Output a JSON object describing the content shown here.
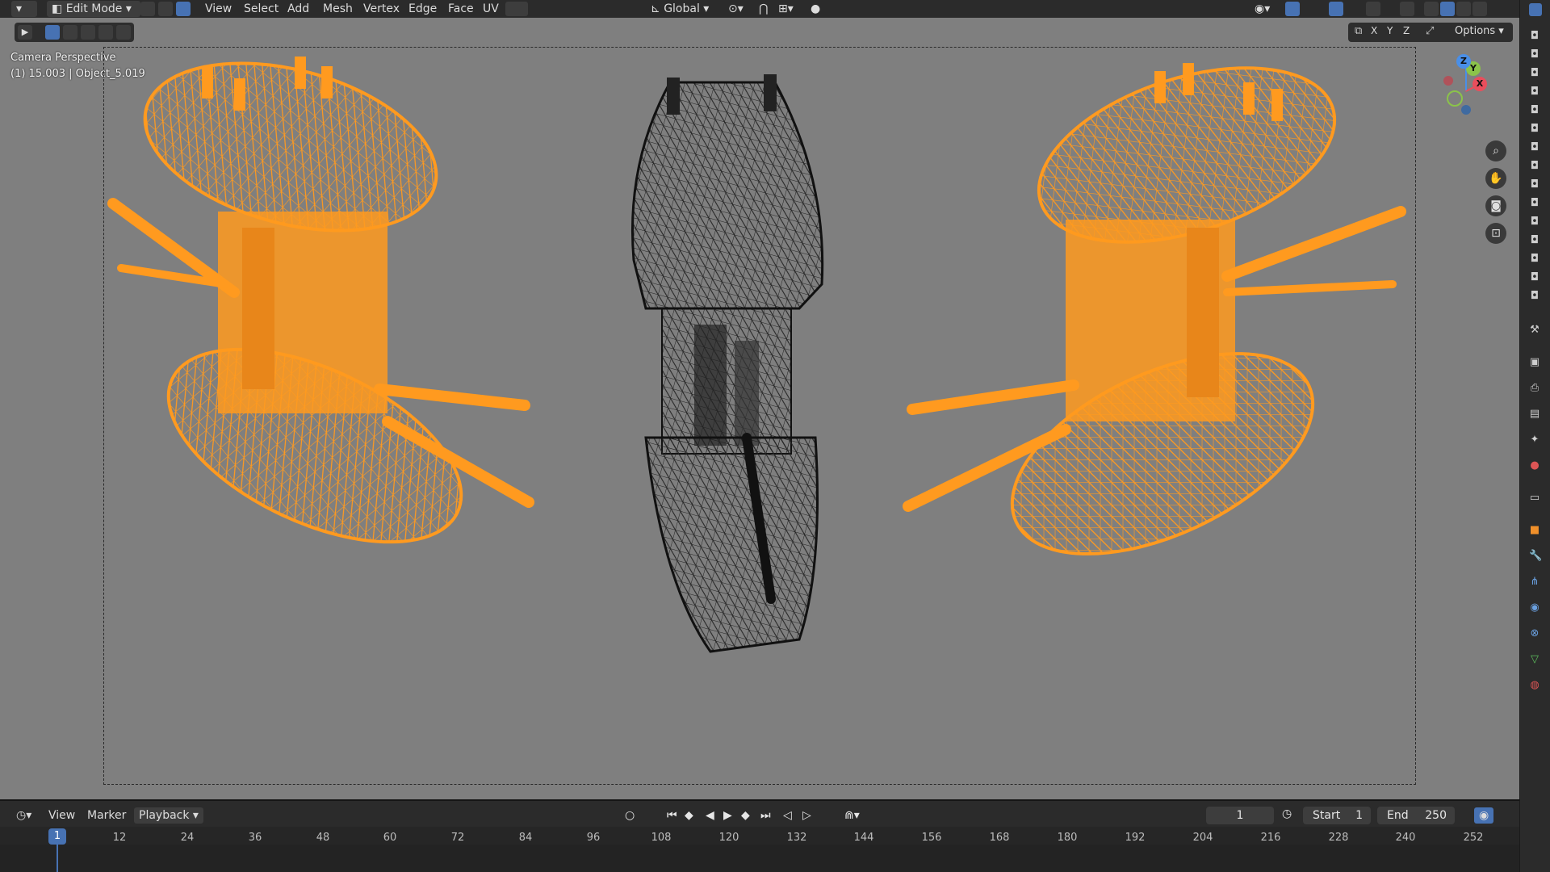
{
  "header": {
    "mode": "Edit Mode",
    "menus": [
      "View",
      "Select",
      "Add",
      "Mesh",
      "Vertex",
      "Edge",
      "Face",
      "UV"
    ],
    "orientation": "Global",
    "options_label": "Options",
    "axes": [
      "X",
      "Y",
      "Z"
    ]
  },
  "viewport": {
    "view_name": "Camera Perspective",
    "object_info": "(1) 15.003 | Object_5.019",
    "gizmo": {
      "x": "X",
      "y": "Y",
      "z": "Z"
    },
    "colors": {
      "background": "#7f7f7f",
      "selected_wire": "#ff9a1f",
      "unselected_wire": "#1a1a1a"
    }
  },
  "timeline": {
    "menus": [
      "View",
      "Marker",
      "Playback"
    ],
    "current_frame": "1",
    "start_label": "Start",
    "start": "1",
    "end_label": "End",
    "end": "250",
    "playhead": "1",
    "ticks": [
      "12",
      "24",
      "36",
      "48",
      "60",
      "72",
      "84",
      "96",
      "108",
      "120",
      "132",
      "144",
      "156",
      "168",
      "180",
      "192",
      "204",
      "216",
      "228",
      "240",
      "252"
    ]
  },
  "icons": {
    "editor_type": "3d-viewport-icon",
    "zoom": "zoom-icon",
    "pan": "hand-icon",
    "camera": "camera-icon",
    "lock": "lock-icon",
    "clock": "clock-icon"
  }
}
